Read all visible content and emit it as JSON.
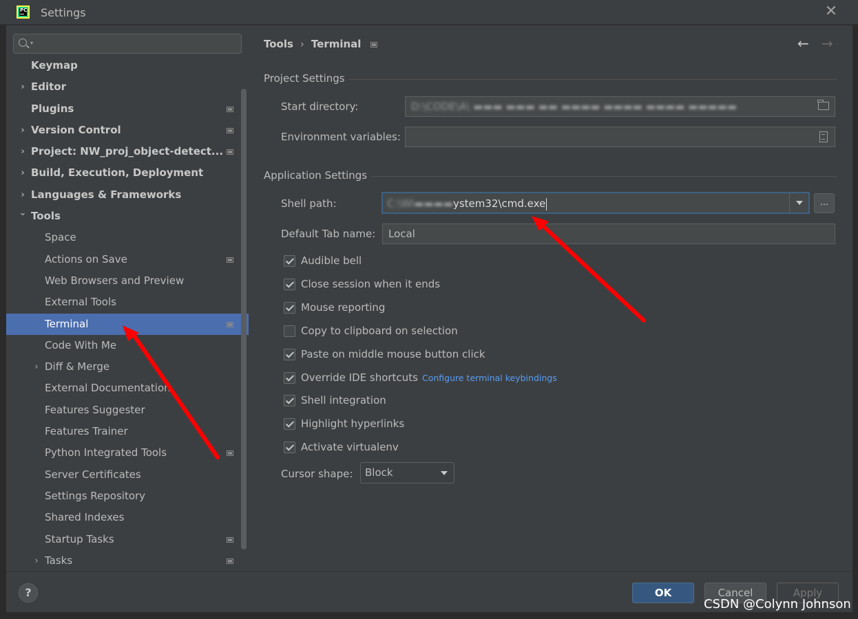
{
  "window": {
    "title": "Settings",
    "logo_text": "PC"
  },
  "search": {
    "placeholder": ""
  },
  "sidebar": {
    "items": [
      {
        "label": "Keymap",
        "level": 0,
        "bold": true,
        "expand": "",
        "pinned": false
      },
      {
        "label": "Editor",
        "level": 0,
        "bold": true,
        "expand": "collapsed",
        "pinned": false
      },
      {
        "label": "Plugins",
        "level": 0,
        "bold": true,
        "expand": "",
        "pinned": true
      },
      {
        "label": "Version Control",
        "level": 0,
        "bold": true,
        "expand": "collapsed",
        "pinned": true
      },
      {
        "label": "Project: NW_proj_object-detect...",
        "level": 0,
        "bold": true,
        "expand": "collapsed",
        "pinned": true
      },
      {
        "label": "Build, Execution, Deployment",
        "level": 0,
        "bold": true,
        "expand": "collapsed",
        "pinned": false
      },
      {
        "label": "Languages & Frameworks",
        "level": 0,
        "bold": true,
        "expand": "collapsed",
        "pinned": false
      },
      {
        "label": "Tools",
        "level": 0,
        "bold": true,
        "expand": "expanded",
        "pinned": false
      },
      {
        "label": "Space",
        "level": 1,
        "bold": false,
        "expand": "",
        "pinned": false
      },
      {
        "label": "Actions on Save",
        "level": 1,
        "bold": false,
        "expand": "",
        "pinned": true
      },
      {
        "label": "Web Browsers and Preview",
        "level": 1,
        "bold": false,
        "expand": "",
        "pinned": false
      },
      {
        "label": "External Tools",
        "level": 1,
        "bold": false,
        "expand": "",
        "pinned": false
      },
      {
        "label": "Terminal",
        "level": 1,
        "bold": false,
        "expand": "",
        "pinned": true,
        "selected": true
      },
      {
        "label": "Code With Me",
        "level": 1,
        "bold": false,
        "expand": "",
        "pinned": false
      },
      {
        "label": "Diff & Merge",
        "level": 1,
        "bold": false,
        "expand": "collapsed",
        "pinned": false
      },
      {
        "label": "External Documentation",
        "level": 1,
        "bold": false,
        "expand": "",
        "pinned": false
      },
      {
        "label": "Features Suggester",
        "level": 1,
        "bold": false,
        "expand": "",
        "pinned": false
      },
      {
        "label": "Features Trainer",
        "level": 1,
        "bold": false,
        "expand": "",
        "pinned": false
      },
      {
        "label": "Python Integrated Tools",
        "level": 1,
        "bold": false,
        "expand": "",
        "pinned": true
      },
      {
        "label": "Server Certificates",
        "level": 1,
        "bold": false,
        "expand": "",
        "pinned": false
      },
      {
        "label": "Settings Repository",
        "level": 1,
        "bold": false,
        "expand": "",
        "pinned": false
      },
      {
        "label": "Shared Indexes",
        "level": 1,
        "bold": false,
        "expand": "",
        "pinned": false
      },
      {
        "label": "Startup Tasks",
        "level": 1,
        "bold": false,
        "expand": "",
        "pinned": true
      },
      {
        "label": "Tasks",
        "level": 1,
        "bold": false,
        "expand": "collapsed",
        "pinned": true
      }
    ]
  },
  "breadcrumb": {
    "parent": "Tools",
    "separator": "›",
    "current": "Terminal"
  },
  "nav": {
    "back_icon": "arrow-left-icon",
    "forward_icon": "arrow-right-icon"
  },
  "project_settings": {
    "title": "Project Settings",
    "start_directory_label": "Start directory:",
    "environment_variables_label": "Environment variables:",
    "environment_variables_value": ""
  },
  "application_settings": {
    "title": "Application Settings",
    "shell_path_label": "Shell path:",
    "shell_path_value_visible": "ystem32\\cmd.exe",
    "ellipsis_label": "...",
    "default_tab_label": "Default Tab name:",
    "default_tab_value": "Local",
    "checkboxes": [
      {
        "label": "Audible bell",
        "checked": true
      },
      {
        "label": "Close session when it ends",
        "checked": true
      },
      {
        "label": "Mouse reporting",
        "checked": true
      },
      {
        "label": "Copy to clipboard on selection",
        "checked": false
      },
      {
        "label": "Paste on middle mouse button click",
        "checked": true
      },
      {
        "label": "Override IDE shortcuts",
        "checked": true,
        "link": "Configure terminal keybindings"
      },
      {
        "label": "Shell integration",
        "checked": true
      },
      {
        "label": "Highlight hyperlinks",
        "checked": true
      },
      {
        "label": "Activate virtualenv",
        "checked": true
      }
    ],
    "cursor_shape_label": "Cursor shape:",
    "cursor_shape_value": "Block"
  },
  "footer": {
    "help_label": "?",
    "ok_label": "OK",
    "cancel_label": "Cancel",
    "apply_label": "Apply"
  },
  "watermark": "CSDN @Colynn Johnson",
  "colors": {
    "selection": "#4b6eaf",
    "panel": "#3c3f41",
    "link": "#589df6",
    "annotation_arrow": "#ff0000",
    "ok_button": "#365880"
  }
}
